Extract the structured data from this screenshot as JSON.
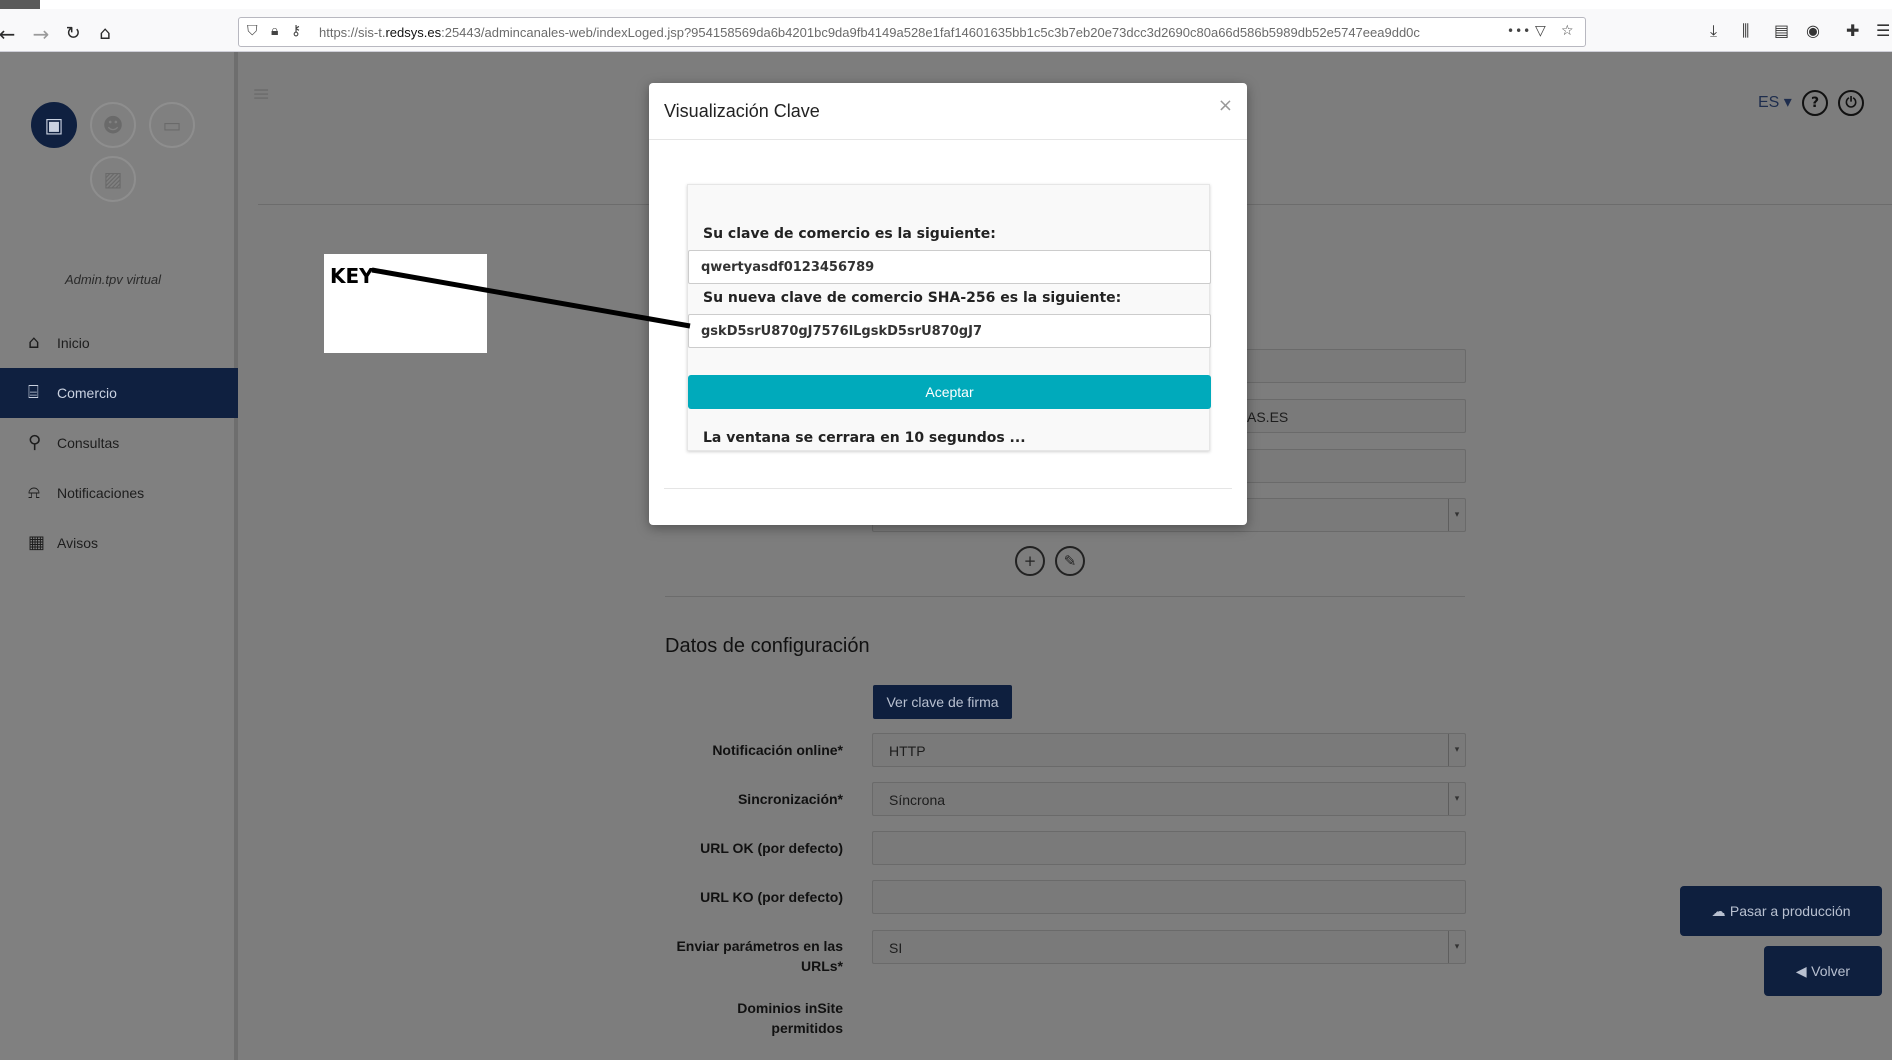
{
  "browser": {
    "url_prefix": "https://sis-t.",
    "url_domain": "redsys.es",
    "url_rest": ":25443/admincanales-web/indexLoged.jsp?954158569da6b4201bc9da9fb4149a528e1faf14601635bb1c5c3b7eb20e73dcc3d2690c80a66d586b5989db52e5747eea9dd0c",
    "menu_dots": "•••"
  },
  "sidebar": {
    "user_label": "Admin.tpv virtual",
    "items": [
      {
        "label": "Inicio",
        "icon": "home-icon"
      },
      {
        "label": "Comercio",
        "icon": "store-icon"
      },
      {
        "label": "Consultas",
        "icon": "search-icon"
      },
      {
        "label": "Notificaciones",
        "icon": "bell-icon"
      },
      {
        "label": "Avisos",
        "icon": "newspaper-icon"
      }
    ]
  },
  "header": {
    "lang": "ES ▾",
    "help": "?"
  },
  "background_form": {
    "partial_email_value": "AS.ES",
    "section_title": "Datos de configuración",
    "ver_clave_button": "Ver clave de firma",
    "fields": [
      {
        "label": "Notificación online*",
        "value": "HTTP"
      },
      {
        "label": "Sincronización*",
        "value": "Síncrona"
      },
      {
        "label": "URL OK (por defecto)",
        "value": ""
      },
      {
        "label": "URL KO (por defecto)",
        "value": ""
      },
      {
        "label": "Enviar parámetros en las URLs*",
        "value": "SI"
      },
      {
        "label": "Dominios inSite permitidos",
        "value": ""
      }
    ],
    "pasar_button": "Pasar a producción",
    "volver_button": "Volver"
  },
  "annotation": {
    "label": "KEY"
  },
  "modal": {
    "title": "Visualización Clave",
    "close": "×",
    "label_key": "Su clave de comercio es la siguiente:",
    "value_key": "qwertyasdf0123456789",
    "label_sha": "Su nueva clave de comercio SHA-256 es la siguiente:",
    "value_sha": "gskD5srU870gJ7576lLgskD5srU870gJ7",
    "accept": "Aceptar",
    "countdown": "La ventana se cerrara en 10 segundos ..."
  }
}
